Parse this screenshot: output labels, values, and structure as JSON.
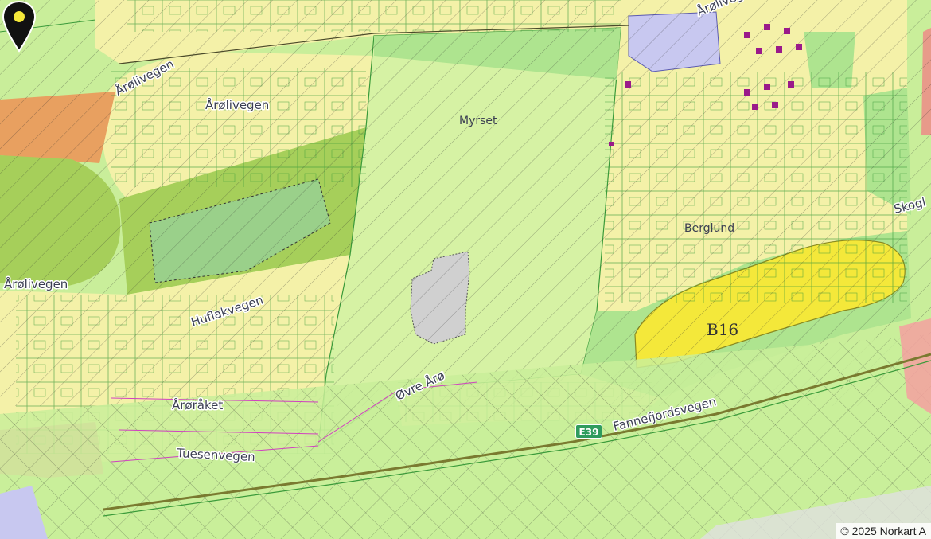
{
  "map": {
    "attribution": "© 2025 Norkart A",
    "colors": {
      "residential": "#f4f1a8",
      "agricultural": "#c9ee9a",
      "green_area": "#aee48f",
      "park": "#a6cf5a",
      "lake": "#9ad08a",
      "commercial": "#e8a060",
      "public": "#c8c8f0",
      "built": "#f4f1a8",
      "highlight": "#f4e83a",
      "road_zone": "#f4a0a0",
      "grey_building": "#d0d0d0",
      "line": "#3a9a3a",
      "property_line": "#d040c0"
    },
    "labels": {
      "arolivegen_top": "Årølivegen",
      "arolivegen_mid": "Årølivegen",
      "arolivegen_left": "Årølivegen",
      "arolivegen_topright": "Årølivegen",
      "myrset": "Myrset",
      "berglund": "Berglund",
      "skog": "Skogl",
      "huflakvegen": "Huflakvegen",
      "ovre_aro": "Øvre Årø",
      "arorakaet": "Årøråket",
      "tuesenvegen": "Tuesenvegen",
      "fannefjordsvegen": "Fannefjordsvegen"
    },
    "road_shield": "E39",
    "zone_code": "B16",
    "marker": {
      "icon": "map-pin-icon"
    }
  }
}
